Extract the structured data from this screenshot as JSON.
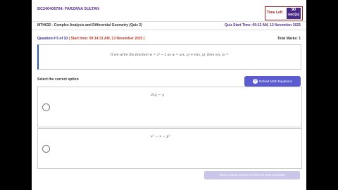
{
  "header": {
    "student": "BC240406704: FARZANA SULTAN",
    "timer_label": "Time Left",
    "timer_value_top": "90",
    "timer_value_bottom": "sec(s)"
  },
  "course": {
    "title": "MTH632 - Complex Analysis and Differential Geometry (Quiz 2)",
    "quiz_start": "Quiz Start Time: 09:13 AM, 13 November 2025"
  },
  "question": {
    "number": "Question # 5 of 10",
    "start": "( Start time: 09:14:31 AM, 13 November 2025 )",
    "marks_label": "Total Marks: 1",
    "text": "If we write the function w = z² − 2 as w = u(x, y) + iv(x, y), then v(x, y) ="
  },
  "options": {
    "select_label": "Select the correct option",
    "math_button": "Reload Math Equations",
    "items": [
      {
        "text": "2xy − y"
      },
      {
        "text": "x² − x − y²"
      }
    ]
  },
  "footer": {
    "next_button": "Click to Save Answer & Move to Next Question"
  }
}
